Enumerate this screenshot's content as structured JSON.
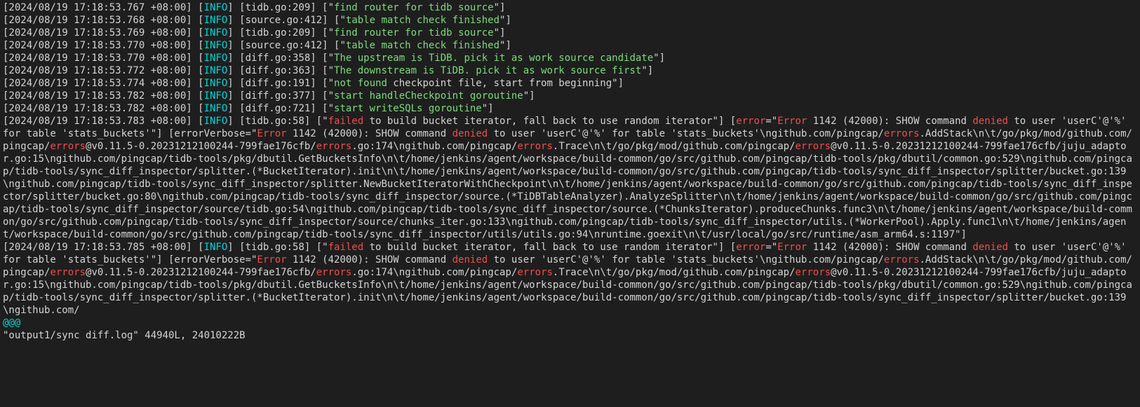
{
  "log_lines": [
    [
      {
        "c": "white",
        "t": "[2024/08/19 17:18:53.767 +08:00] ["
      },
      {
        "c": "cyan",
        "t": "INFO"
      },
      {
        "c": "white",
        "t": "] [tidb.go:209] [\""
      },
      {
        "c": "green",
        "t": "find router for tidb source"
      },
      {
        "c": "white",
        "t": "\"]"
      }
    ],
    [
      {
        "c": "white",
        "t": "[2024/08/19 17:18:53.768 +08:00] ["
      },
      {
        "c": "cyan",
        "t": "INFO"
      },
      {
        "c": "white",
        "t": "] [source.go:412] [\""
      },
      {
        "c": "green",
        "t": "table match check finished"
      },
      {
        "c": "white",
        "t": "\"]"
      }
    ],
    [
      {
        "c": "white",
        "t": "[2024/08/19 17:18:53.769 +08:00] ["
      },
      {
        "c": "cyan",
        "t": "INFO"
      },
      {
        "c": "white",
        "t": "] [tidb.go:209] [\""
      },
      {
        "c": "green",
        "t": "find router for tidb source"
      },
      {
        "c": "white",
        "t": "\"]"
      }
    ],
    [
      {
        "c": "white",
        "t": "[2024/08/19 17:18:53.770 +08:00] ["
      },
      {
        "c": "cyan",
        "t": "INFO"
      },
      {
        "c": "white",
        "t": "] [source.go:412] [\""
      },
      {
        "c": "green",
        "t": "table match check finished"
      },
      {
        "c": "white",
        "t": "\"]"
      }
    ],
    [
      {
        "c": "white",
        "t": "[2024/08/19 17:18:53.770 +08:00] ["
      },
      {
        "c": "cyan",
        "t": "INFO"
      },
      {
        "c": "white",
        "t": "] [diff.go:358] [\""
      },
      {
        "c": "green",
        "t": "The upstream is TiDB. pick it as work source candidate"
      },
      {
        "c": "white",
        "t": "\"]"
      }
    ],
    [
      {
        "c": "white",
        "t": "[2024/08/19 17:18:53.772 +08:00] ["
      },
      {
        "c": "cyan",
        "t": "INFO"
      },
      {
        "c": "white",
        "t": "] [diff.go:363] [\""
      },
      {
        "c": "green",
        "t": "The downstream is TiDB. pick it as work source first"
      },
      {
        "c": "white",
        "t": "\"]"
      }
    ],
    [
      {
        "c": "white",
        "t": "[2024/08/19 17:18:53.774 +08:00] ["
      },
      {
        "c": "cyan",
        "t": "INFO"
      },
      {
        "c": "white",
        "t": "] [diff.go:191] [\""
      },
      {
        "c": "green",
        "t": "not found"
      },
      {
        "c": "white",
        "t": " checkpoint file, start from beginning\"]"
      }
    ],
    [
      {
        "c": "white",
        "t": "[2024/08/19 17:18:53.782 +08:00] ["
      },
      {
        "c": "cyan",
        "t": "INFO"
      },
      {
        "c": "white",
        "t": "] [diff.go:377] [\""
      },
      {
        "c": "green",
        "t": "start handleCheckpoint goroutine"
      },
      {
        "c": "white",
        "t": "\"]"
      }
    ],
    [
      {
        "c": "white",
        "t": "[2024/08/19 17:18:53.782 +08:00] ["
      },
      {
        "c": "cyan",
        "t": "INFO"
      },
      {
        "c": "white",
        "t": "] [diff.go:721] [\""
      },
      {
        "c": "green",
        "t": "start writeSQLs goroutine"
      },
      {
        "c": "white",
        "t": "\"]"
      }
    ],
    [
      {
        "c": "white",
        "t": "[2024/08/19 17:18:53.783 +08:00] ["
      },
      {
        "c": "cyan",
        "t": "INFO"
      },
      {
        "c": "white",
        "t": "] [tidb.go:58] [\""
      },
      {
        "c": "red",
        "t": "failed"
      },
      {
        "c": "white",
        "t": " to build bucket iterator, fall back to use random iterator\"] ["
      },
      {
        "c": "red",
        "t": "error"
      },
      {
        "c": "white",
        "t": "=\""
      },
      {
        "c": "red",
        "t": "Error"
      },
      {
        "c": "white",
        "t": " 1142 (42000): SHOW command "
      },
      {
        "c": "red",
        "t": "denied"
      },
      {
        "c": "white",
        "t": " to user 'userC'@'%' for table 'stats_buckets'\"] [errorVerbose=\""
      },
      {
        "c": "red",
        "t": "Error"
      },
      {
        "c": "white",
        "t": " 1142 (42000): SHOW command "
      },
      {
        "c": "red",
        "t": "denied"
      },
      {
        "c": "white",
        "t": " to user 'userC'@'%' for table 'stats_buckets'\\ngithub.com/pingcap/"
      },
      {
        "c": "red",
        "t": "errors"
      },
      {
        "c": "white",
        "t": ".AddStack\\n\\t/go/pkg/mod/github.com/pingcap/"
      },
      {
        "c": "red",
        "t": "errors"
      },
      {
        "c": "white",
        "t": "@v0.11.5-0.20231212100244-799fae176cfb/"
      },
      {
        "c": "red",
        "t": "errors"
      },
      {
        "c": "white",
        "t": ".go:174\\ngithub.com/pingcap/"
      },
      {
        "c": "red",
        "t": "errors"
      },
      {
        "c": "white",
        "t": ".Trace\\n\\t/go/pkg/mod/github.com/pingcap/"
      },
      {
        "c": "red",
        "t": "errors"
      },
      {
        "c": "white",
        "t": "@v0.11.5-0.20231212100244-799fae176cfb/juju_adaptor.go:15\\ngithub.com/pingcap/tidb-tools/pkg/dbutil.GetBucketsInfo\\n\\t/home/jenkins/agent/workspace/build-common/go/src/github.com/pingcap/tidb-tools/pkg/dbutil/common.go:529\\ngithub.com/pingcap/tidb-tools/sync_diff_inspector/splitter.(*BucketIterator).init\\n\\t/home/jenkins/agent/workspace/build-common/go/src/github.com/pingcap/tidb-tools/sync_diff_inspector/splitter/bucket.go:139\\ngithub.com/pingcap/tidb-tools/sync_diff_inspector/splitter.NewBucketIteratorWithCheckpoint\\n\\t/home/jenkins/agent/workspace/build-common/go/src/github.com/pingcap/tidb-tools/sync_diff_inspector/splitter/bucket.go:80\\ngithub.com/pingcap/tidb-tools/sync_diff_inspector/source.(*TiDBTableAnalyzer).AnalyzeSplitter\\n\\t/home/jenkins/agent/workspace/build-common/go/src/github.com/pingcap/tidb-tools/sync_diff_inspector/source/tidb.go:54\\ngithub.com/pingcap/tidb-tools/sync_diff_inspector/source.(*ChunksIterator).produceChunks.func3\\n\\t/home/jenkins/agent/workspace/build-common/go/src/github.com/pingcap/tidb-tools/sync_diff_inspector/source/chunks_iter.go:133\\ngithub.com/pingcap/tidb-tools/sync_diff_inspector/utils.(*WorkerPool).Apply.func1\\n\\t/home/jenkins/agent/workspace/build-common/go/src/github.com/pingcap/tidb-tools/sync_diff_inspector/utils/utils.go:94\\nruntime.goexit\\n\\t/usr/local/go/src/runtime/asm_arm64.s:1197\"]"
      }
    ],
    [
      {
        "c": "white",
        "t": "[2024/08/19 17:18:53.785 +08:00] ["
      },
      {
        "c": "cyan",
        "t": "INFO"
      },
      {
        "c": "white",
        "t": "] [tidb.go:58] [\""
      },
      {
        "c": "red",
        "t": "failed"
      },
      {
        "c": "white",
        "t": " to build bucket iterator, fall back to use random iterator\"] ["
      },
      {
        "c": "red",
        "t": "error"
      },
      {
        "c": "white",
        "t": "=\""
      },
      {
        "c": "red",
        "t": "Error"
      },
      {
        "c": "white",
        "t": " 1142 (42000): SHOW command "
      },
      {
        "c": "red",
        "t": "denied"
      },
      {
        "c": "white",
        "t": " to user 'userC'@'%' for table 'stats_buckets'\"] [errorVerbose=\""
      },
      {
        "c": "red",
        "t": "Error"
      },
      {
        "c": "white",
        "t": " 1142 (42000): SHOW command "
      },
      {
        "c": "red",
        "t": "denied"
      },
      {
        "c": "white",
        "t": " to user 'userC'@'%' for table 'stats_buckets'\\ngithub.com/pingcap/"
      },
      {
        "c": "red",
        "t": "errors"
      },
      {
        "c": "white",
        "t": ".AddStack\\n\\t/go/pkg/mod/github.com/pingcap/"
      },
      {
        "c": "red",
        "t": "errors"
      },
      {
        "c": "white",
        "t": "@v0.11.5-0.20231212100244-799fae176cfb/"
      },
      {
        "c": "red",
        "t": "errors"
      },
      {
        "c": "white",
        "t": ".go:174\\ngithub.com/pingcap/"
      },
      {
        "c": "red",
        "t": "errors"
      },
      {
        "c": "white",
        "t": ".Trace\\n\\t/go/pkg/mod/github.com/pingcap/"
      },
      {
        "c": "red",
        "t": "errors"
      },
      {
        "c": "white",
        "t": "@v0.11.5-0.20231212100244-799fae176cfb/juju_adaptor.go:15\\ngithub.com/pingcap/tidb-tools/pkg/dbutil.GetBucketsInfo\\n\\t/home/jenkins/agent/workspace/build-common/go/src/github.com/pingcap/tidb-tools/pkg/dbutil/common.go:529\\ngithub.com/pingcap/tidb-tools/sync_diff_inspector/splitter.(*BucketIterator).init\\n\\t/home/jenkins/agent/workspace/build-common/go/src/github.com/pingcap/tidb-tools/sync_diff_inspector/splitter/bucket.go:139\\ngithub.com/"
      }
    ],
    [
      {
        "c": "cyan",
        "t": "@@@"
      }
    ]
  ],
  "status_line": "\"output1/sync diff.log\" 44940L, 24010222B"
}
